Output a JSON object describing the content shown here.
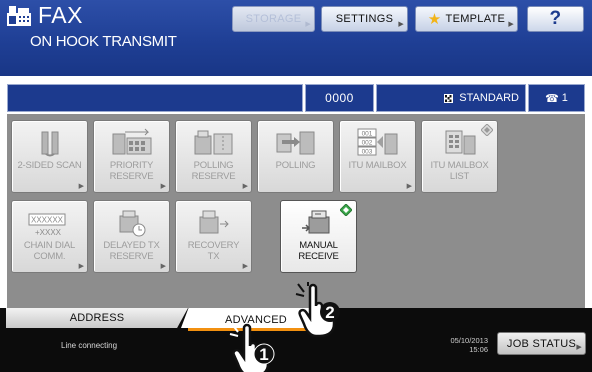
{
  "header": {
    "app_title": "FAX",
    "subtitle": "ON HOOK TRANSMIT",
    "storage_label": "STORAGE",
    "settings_label": "SETTINGS",
    "template_label": "TEMPLATE",
    "help_label": "?"
  },
  "status": {
    "counter": "0000",
    "mode": "STANDARD",
    "line": "1"
  },
  "functions": [
    {
      "label": "2-SIDED SCAN",
      "enabled": false,
      "icon": "duplex-scan-icon"
    },
    {
      "label": "PRIORITY\nRESERVE",
      "enabled": false,
      "icon": "priority-reserve-icon"
    },
    {
      "label": "POLLING\nRESERVE",
      "enabled": false,
      "icon": "polling-reserve-icon"
    },
    {
      "label": "POLLING",
      "enabled": false,
      "icon": "polling-icon"
    },
    {
      "label": "ITU MAILBOX",
      "enabled": false,
      "icon": "itu-mailbox-icon",
      "icon_text": [
        "001",
        "002",
        "003"
      ]
    },
    {
      "label": "ITU MAILBOX\nLIST",
      "enabled": false,
      "icon": "itu-mailbox-list-icon"
    },
    {
      "label": "CHAIN DIAL\nCOMM.",
      "enabled": false,
      "icon": "chain-dial-icon",
      "icon_text": [
        "XXXXXX",
        "+XXXX"
      ]
    },
    {
      "label": "DELAYED TX\nRESERVE",
      "enabled": false,
      "icon": "delayed-tx-icon"
    },
    {
      "label": "RECOVERY\nTX",
      "enabled": false,
      "icon": "recovery-tx-icon"
    },
    {
      "label": "MANUAL\nRECEIVE",
      "enabled": true,
      "icon": "manual-receive-icon"
    }
  ],
  "tabs": {
    "address": "ADDRESS",
    "advanced": "ADVANCED"
  },
  "footer": {
    "status_text": "Line connecting",
    "date": "05/10/2013",
    "time": "15:06",
    "job_status_label": "JOB STATUS"
  },
  "callouts": [
    "1",
    "2"
  ],
  "colors": {
    "header_blue": "#1f3f95",
    "panel_gray": "#8d8d8d",
    "active_tab_accent": "#f29010",
    "diamond_green": "#3aa84a"
  }
}
